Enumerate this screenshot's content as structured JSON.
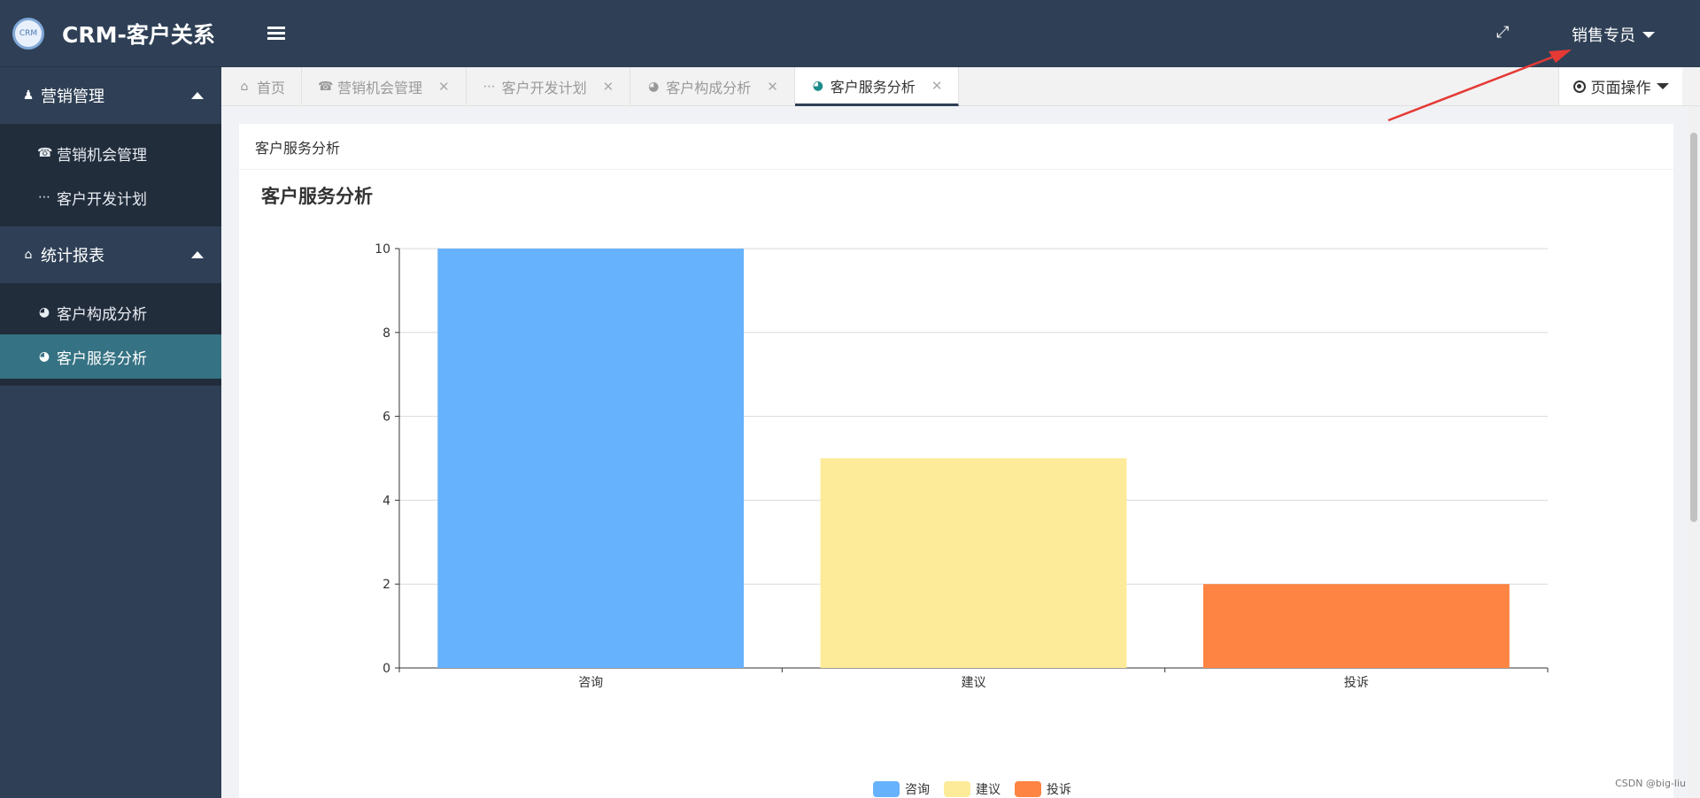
{
  "brand": {
    "logo_text": "CRM",
    "title": "CRM-客户关系"
  },
  "sidebar": {
    "groups": [
      {
        "label": "营销管理",
        "icon": "person-icon",
        "items": [
          {
            "label": "营销机会管理",
            "icon": "phone-icon"
          },
          {
            "label": "客户开发计划",
            "icon": "ellipsis-icon"
          }
        ]
      },
      {
        "label": "统计报表",
        "icon": "home-icon",
        "items": [
          {
            "label": "客户构成分析",
            "icon": "dashboard-icon"
          },
          {
            "label": "客户服务分析",
            "icon": "dashboard-icon",
            "active": true
          }
        ]
      }
    ]
  },
  "header": {
    "user_label": "销售专员"
  },
  "tabs": [
    {
      "label": "首页",
      "icon": "home-icon",
      "closable": false
    },
    {
      "label": "营销机会管理",
      "icon": "phone-icon",
      "closable": true
    },
    {
      "label": "客户开发计划",
      "icon": "ellipsis-icon",
      "closable": true
    },
    {
      "label": "客户构成分析",
      "icon": "dashboard-icon",
      "closable": true
    },
    {
      "label": "客户服务分析",
      "icon": "dashboard-icon",
      "closable": true,
      "active": true
    }
  ],
  "page_ops_label": "页面操作",
  "card": {
    "header": "客户服务分析"
  },
  "chart_data": {
    "type": "bar",
    "title": "客户服务分析",
    "categories": [
      "咨询",
      "建议",
      "投诉"
    ],
    "values": [
      10,
      5,
      2
    ],
    "colors": [
      "#67b2fd",
      "#feeb99",
      "#fd8442"
    ],
    "ylim": [
      0,
      10
    ],
    "yticks": [
      0,
      2,
      4,
      6,
      8,
      10
    ],
    "grid": true,
    "legend": [
      "咨询",
      "建议",
      "投诉"
    ],
    "legend_placement": "bottom-center"
  },
  "watermark": "CSDN @big-liu",
  "colors": {
    "sidebar_bg": "#2f4056",
    "submenu_bg": "#222d3c",
    "active_item": "#357283",
    "annotation_arrow": "#e53935"
  }
}
